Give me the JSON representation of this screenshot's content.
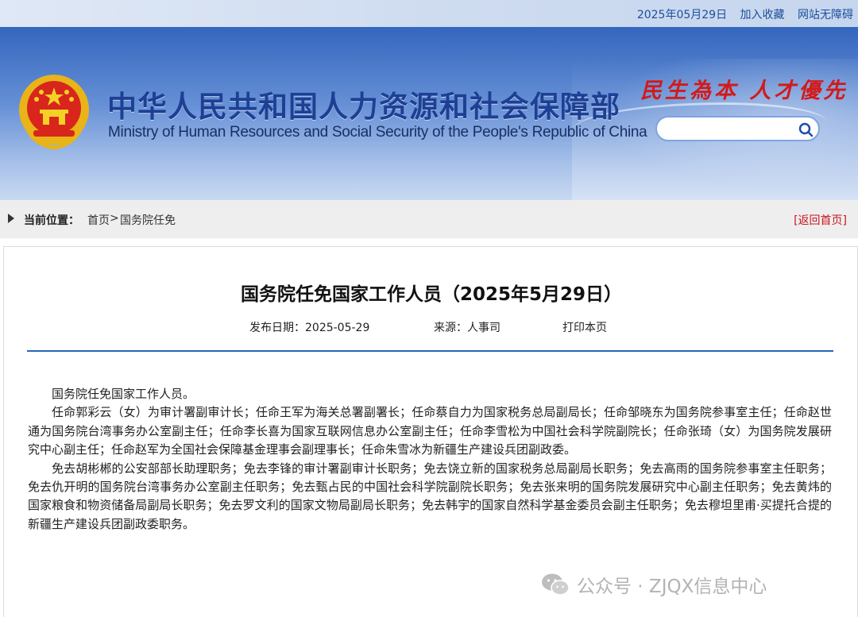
{
  "topbar": {
    "date": "2025年05月29日",
    "favorite_label": "加入收藏",
    "accessibility_label": "网站无障碍"
  },
  "header": {
    "title_cn": "中华人民共和国人力资源和社会保障部",
    "title_en": "Ministry of Human Resources and Social Security of the People's Republic of China",
    "slogan": "民生為本  人才優先",
    "search": {
      "value": "",
      "placeholder": ""
    }
  },
  "breadcrumb": {
    "label": "当前位置：",
    "home": "首页",
    "separator": ">",
    "current": "国务院任免",
    "back_link": "[返回首页]"
  },
  "article": {
    "title": "国务院任免国家工作人员（2025年5月29日）",
    "publish_date_label": "发布日期：",
    "publish_date": "2025-05-29",
    "source_label": "来源：",
    "source": "人事司",
    "print_label": "打印本页",
    "paragraphs": [
      "国务院任免国家工作人员。",
      "任命郭彩云（女）为审计署副审计长；任命王军为海关总署副署长；任命蔡自力为国家税务总局副局长；任命邹晓东为国务院参事室主任；任命赵世通为国务院台湾事务办公室副主任；任命李长喜为国家互联网信息办公室副主任；任命李雪松为中国社会科学院副院长；任命张琦（女）为国务院发展研究中心副主任；任命赵军为全国社会保障基金理事会副理事长；任命朱雪冰为新疆生产建设兵团副政委。",
      "免去胡彬郴的公安部部长助理职务；免去李锋的审计署副审计长职务；免去饶立新的国家税务总局副局长职务；免去高雨的国务院参事室主任职务；免去仇开明的国务院台湾事务办公室副主任职务；免去甄占民的中国社会科学院副院长职务；免去张来明的国务院发展研究中心副主任职务；免去黄炜的国家粮食和物资储备局副局长职务；免去罗文利的国家文物局副局长职务；免去韩宇的国家自然科学基金委员会副主任职务；免去穆坦里甫·买提托合提的新疆生产建设兵团副政委职务。"
    ]
  },
  "watermark": {
    "text": "公众号 · ZJQX信息中心",
    "icon": "wechat-icon"
  },
  "colors": {
    "banner_blue": "#3466be",
    "title_blue": "#1d3f94",
    "slogan_red": "#d21a1a",
    "link_blue": "#1c4f9c",
    "back_red": "#c8161d",
    "rule_blue": "#2b63b6"
  }
}
